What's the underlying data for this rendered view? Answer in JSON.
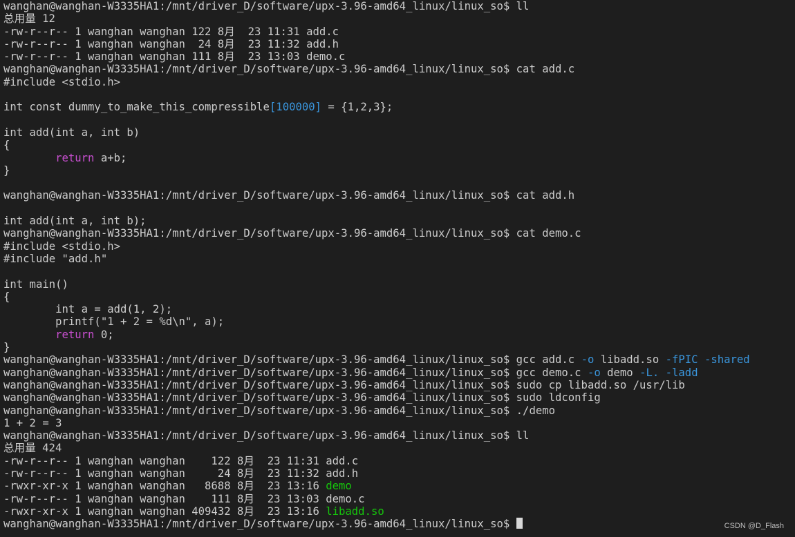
{
  "terminal": {
    "background": "#1e1e1e",
    "foreground": "#cccccc",
    "colors": {
      "plain": "#cccccc",
      "keyword": "#c84fd0",
      "number": "#3a96dd",
      "option": "#3a96dd",
      "exec": "#16c60c"
    },
    "lines": [
      [
        {
          "t": "wanghan@wanghan-W3335HA1:/mnt/driver_D/software/upx-3.96-amd64_linux/linux_so$ ll",
          "c": "plain"
        }
      ],
      [
        {
          "t": "总用量 12",
          "c": "plain"
        }
      ],
      [
        {
          "t": "-rw-r--r-- 1 wanghan wanghan 122 8月  23 11:31 add.c",
          "c": "plain"
        }
      ],
      [
        {
          "t": "-rw-r--r-- 1 wanghan wanghan  24 8月  23 11:32 add.h",
          "c": "plain"
        }
      ],
      [
        {
          "t": "-rw-r--r-- 1 wanghan wanghan 111 8月  23 13:03 demo.c",
          "c": "plain"
        }
      ],
      [
        {
          "t": "wanghan@wanghan-W3335HA1:/mnt/driver_D/software/upx-3.96-amd64_linux/linux_so$ cat add.c",
          "c": "plain"
        }
      ],
      [
        {
          "t": "#include <stdio.h>",
          "c": "plain"
        }
      ],
      [
        {
          "t": "",
          "c": "plain"
        }
      ],
      [
        {
          "t": "int const dummy_to_make_this_compressible",
          "c": "plain"
        },
        {
          "t": "[100000]",
          "c": "number"
        },
        {
          "t": " = {1,2,3};",
          "c": "plain"
        }
      ],
      [
        {
          "t": "",
          "c": "plain"
        }
      ],
      [
        {
          "t": "int add(int a, int b)",
          "c": "plain"
        }
      ],
      [
        {
          "t": "{",
          "c": "plain"
        }
      ],
      [
        {
          "t": "        ",
          "c": "plain"
        },
        {
          "t": "return",
          "c": "keyword"
        },
        {
          "t": " a+b;",
          "c": "plain"
        }
      ],
      [
        {
          "t": "}",
          "c": "plain"
        }
      ],
      [
        {
          "t": "",
          "c": "plain"
        }
      ],
      [
        {
          "t": "wanghan@wanghan-W3335HA1:/mnt/driver_D/software/upx-3.96-amd64_linux/linux_so$ cat add.h",
          "c": "plain"
        }
      ],
      [
        {
          "t": "",
          "c": "plain"
        }
      ],
      [
        {
          "t": "int add(int a, int b);",
          "c": "plain"
        }
      ],
      [
        {
          "t": "wanghan@wanghan-W3335HA1:/mnt/driver_D/software/upx-3.96-amd64_linux/linux_so$ cat demo.c",
          "c": "plain"
        }
      ],
      [
        {
          "t": "#include <stdio.h>",
          "c": "plain"
        }
      ],
      [
        {
          "t": "#include \"add.h\"",
          "c": "plain"
        }
      ],
      [
        {
          "t": "",
          "c": "plain"
        }
      ],
      [
        {
          "t": "int main()",
          "c": "plain"
        }
      ],
      [
        {
          "t": "{",
          "c": "plain"
        }
      ],
      [
        {
          "t": "        int a = add(1, 2);",
          "c": "plain"
        }
      ],
      [
        {
          "t": "        printf(\"1 + 2 = %d\\n\", a);",
          "c": "plain"
        }
      ],
      [
        {
          "t": "        ",
          "c": "plain"
        },
        {
          "t": "return",
          "c": "keyword"
        },
        {
          "t": " 0;",
          "c": "plain"
        }
      ],
      [
        {
          "t": "}",
          "c": "plain"
        }
      ],
      [
        {
          "t": "wanghan@wanghan-W3335HA1:/mnt/driver_D/software/upx-3.96-amd64_linux/linux_so$ gcc add.c ",
          "c": "plain"
        },
        {
          "t": "-o",
          "c": "option"
        },
        {
          "t": " libadd.so ",
          "c": "plain"
        },
        {
          "t": "-fPIC -shared",
          "c": "option"
        }
      ],
      [
        {
          "t": "wanghan@wanghan-W3335HA1:/mnt/driver_D/software/upx-3.96-amd64_linux/linux_so$ gcc demo.c ",
          "c": "plain"
        },
        {
          "t": "-o",
          "c": "option"
        },
        {
          "t": " demo ",
          "c": "plain"
        },
        {
          "t": "-L.",
          "c": "option"
        },
        {
          "t": " ",
          "c": "plain"
        },
        {
          "t": "-ladd",
          "c": "option"
        }
      ],
      [
        {
          "t": "wanghan@wanghan-W3335HA1:/mnt/driver_D/software/upx-3.96-amd64_linux/linux_so$ sudo cp libadd.so /usr/lib",
          "c": "plain"
        }
      ],
      [
        {
          "t": "wanghan@wanghan-W3335HA1:/mnt/driver_D/software/upx-3.96-amd64_linux/linux_so$ sudo ldconfig",
          "c": "plain"
        }
      ],
      [
        {
          "t": "wanghan@wanghan-W3335HA1:/mnt/driver_D/software/upx-3.96-amd64_linux/linux_so$ ./demo",
          "c": "plain"
        }
      ],
      [
        {
          "t": "1 + 2 = 3",
          "c": "plain"
        }
      ],
      [
        {
          "t": "wanghan@wanghan-W3335HA1:/mnt/driver_D/software/upx-3.96-amd64_linux/linux_so$ ll",
          "c": "plain"
        }
      ],
      [
        {
          "t": "总用量 424",
          "c": "plain"
        }
      ],
      [
        {
          "t": "-rw-r--r-- 1 wanghan wanghan    122 8月  23 11:31 add.c",
          "c": "plain"
        }
      ],
      [
        {
          "t": "-rw-r--r-- 1 wanghan wanghan     24 8月  23 11:32 add.h",
          "c": "plain"
        }
      ],
      [
        {
          "t": "-rwxr-xr-x 1 wanghan wanghan   8688 8月  23 13:16 ",
          "c": "plain"
        },
        {
          "t": "demo",
          "c": "exec"
        }
      ],
      [
        {
          "t": "-rw-r--r-- 1 wanghan wanghan    111 8月  23 13:03 demo.c",
          "c": "plain"
        }
      ],
      [
        {
          "t": "-rwxr-xr-x 1 wanghan wanghan 409432 8月  23 13:16 ",
          "c": "plain"
        },
        {
          "t": "libadd.so",
          "c": "exec"
        }
      ],
      [
        {
          "t": "wanghan@wanghan-W3335HA1:/mnt/driver_D/software/upx-3.96-amd64_linux/linux_so$ ",
          "c": "plain"
        }
      ]
    ]
  },
  "watermark": "CSDN @D_Flash"
}
